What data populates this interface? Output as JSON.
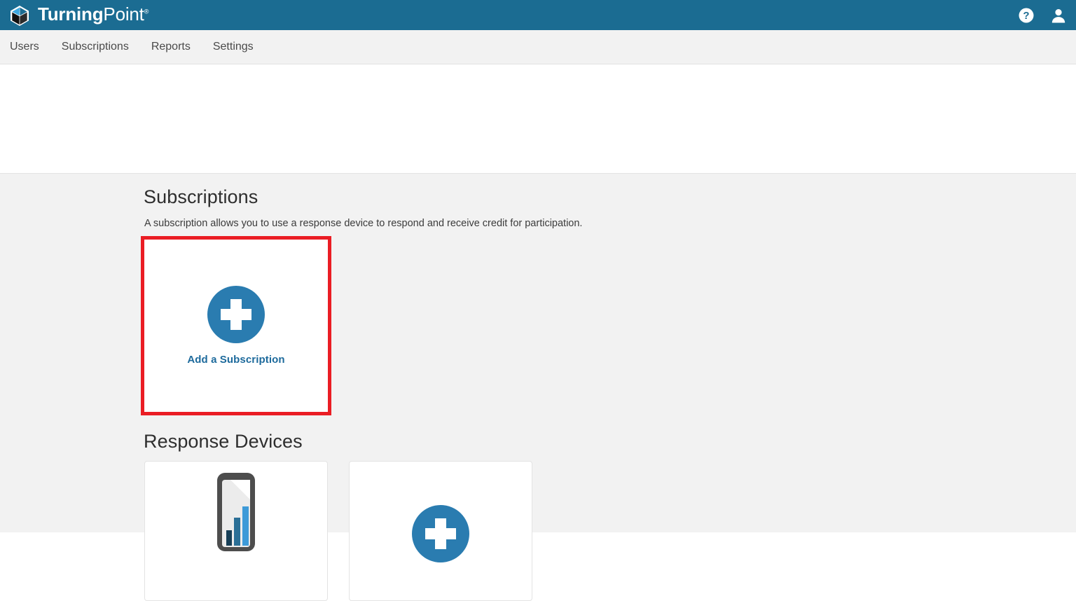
{
  "header": {
    "brand_bold": "Turning",
    "brand_light": "Point",
    "brand_tm": "®",
    "logo_icon": "cube-logo-icon",
    "help_icon": "help-circle-icon",
    "account_icon": "user-account-icon",
    "background_color": "#1b6c92"
  },
  "nav": {
    "items": [
      {
        "label": "Users"
      },
      {
        "label": "Subscriptions"
      },
      {
        "label": "Reports"
      },
      {
        "label": "Settings"
      }
    ]
  },
  "main": {
    "subscriptions": {
      "title": "Subscriptions",
      "description": "A subscription allows you to use a response device to respond and receive credit for participation.",
      "add_card": {
        "label": "Add a Subscription",
        "icon": "plus-circle-icon",
        "accent_color": "#2a7cb0",
        "label_color": "#1d6a9c",
        "highlight_color": "#ea1d24"
      }
    },
    "response_devices": {
      "title": "Response Devices",
      "cards": [
        {
          "name": "mobile-device-card",
          "icon": "mobile-phone-chart-icon"
        },
        {
          "name": "add-device-card",
          "icon": "plus-circle-icon"
        }
      ]
    }
  }
}
